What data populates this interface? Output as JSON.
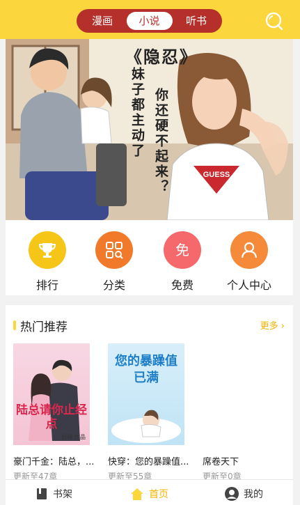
{
  "header": {
    "tabs": [
      {
        "label": "漫画"
      },
      {
        "label": "小说"
      },
      {
        "label": "听书"
      }
    ],
    "active_tab": "小说",
    "search_icon": "search-icon"
  },
  "banner": {
    "title": "《隐忍》",
    "line1": "妹子都主动了",
    "line2": "你还硬不起来？",
    "shirt_text": "GUESS"
  },
  "menu": {
    "items": [
      {
        "label": "排行",
        "icon": "trophy-icon",
        "color": "#f5c518"
      },
      {
        "label": "分类",
        "icon": "grid-icon",
        "color": "#f07a2a"
      },
      {
        "label": "免费",
        "icon": "free-badge-icon",
        "color": "#f5686b"
      },
      {
        "label": "个人中心",
        "icon": "user-icon",
        "color": "#f48a3a"
      }
    ]
  },
  "hot": {
    "title": "热门推荐",
    "more": "更多",
    "books": [
      {
        "title": "豪门千金：陆总，...",
        "updated": "更新至47章",
        "cover_text": "陆总请你止经点",
        "cover_author": "秋缘·作品"
      },
      {
        "title": "快穿：您的暴躁值...",
        "updated": "更新至55章",
        "cover_text": "您的暴躁值已满"
      },
      {
        "title": "席卷天下",
        "updated": "更新至0章"
      }
    ]
  },
  "tabbar": {
    "items": [
      {
        "label": "书架",
        "icon": "bookshelf-icon"
      },
      {
        "label": "首页",
        "icon": "home-icon"
      },
      {
        "label": "我的",
        "icon": "profile-icon"
      }
    ],
    "active": "首页"
  },
  "colors": {
    "accent": "#fbd63c",
    "segment": "#b5302a",
    "more": "#f4b400"
  }
}
